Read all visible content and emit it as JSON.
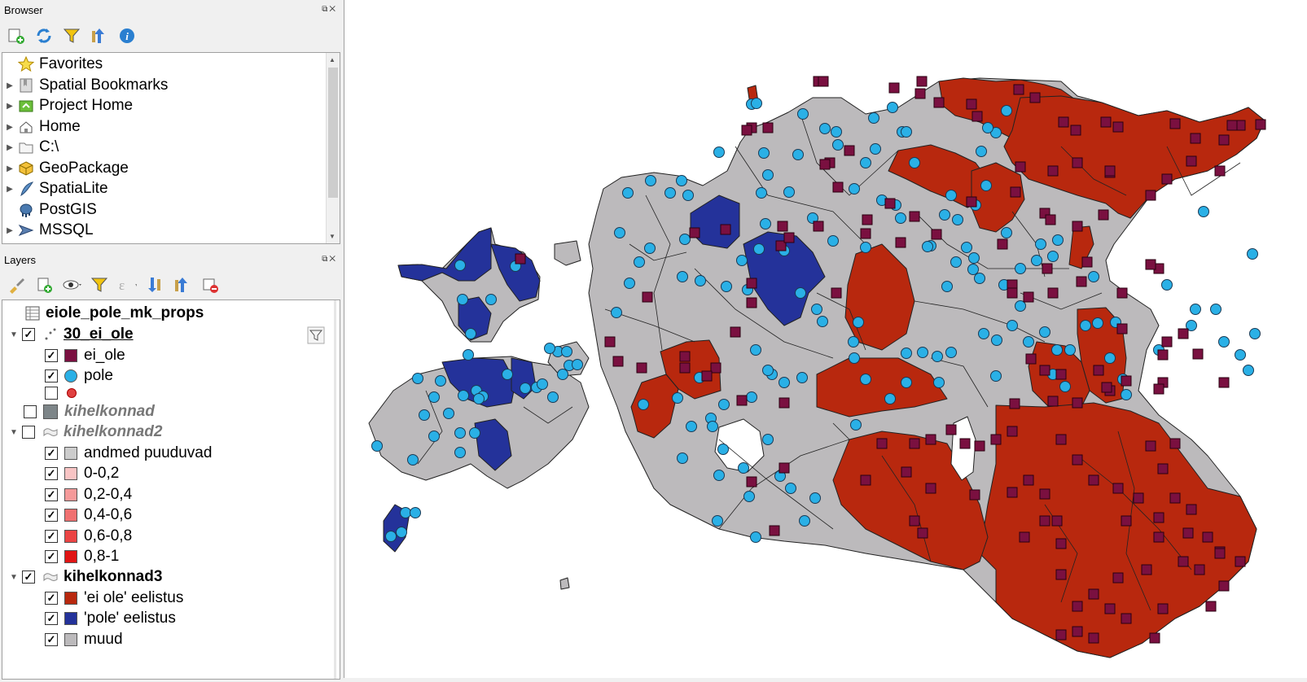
{
  "browser": {
    "title": "Browser",
    "items": [
      {
        "label": "Favorites",
        "icon": "star-icon"
      },
      {
        "label": "Spatial Bookmarks",
        "icon": "bookmark-icon"
      },
      {
        "label": "Project Home",
        "icon": "project-home-icon"
      },
      {
        "label": "Home",
        "icon": "home-icon"
      },
      {
        "label": "C:\\",
        "icon": "folder-icon"
      },
      {
        "label": "GeoPackage",
        "icon": "geopackage-icon"
      },
      {
        "label": "SpatiaLite",
        "icon": "spatialite-icon"
      },
      {
        "label": "PostGIS",
        "icon": "postgis-icon"
      },
      {
        "label": "MSSQL",
        "icon": "mssql-icon"
      }
    ]
  },
  "layers": {
    "title": "Layers",
    "groups": {
      "table": "eiole_pole_mk_props",
      "points": "30_ei_ole",
      "points_items": [
        "ei_ole",
        "pole",
        ""
      ],
      "kih1": "kihelkonnad",
      "kih2": "kihelkonnad2",
      "kih2_items": [
        "andmed puuduvad",
        "0-0,2",
        "0,2-0,4",
        "0,4-0,6",
        "0,6-0,8",
        "0,8-1"
      ],
      "kih3": "kihelkonnad3",
      "kih3_items": [
        "'ei ole' eelistus",
        "'pole' eelistus",
        "muud"
      ]
    }
  },
  "colors": {
    "ei_ole": "#7a1040",
    "pole": "#2ab0e6",
    "red_region": "#b8280e",
    "blue_region": "#24329a",
    "grey_region": "#bcbabc",
    "kih1_swatch": "#7d8588",
    "andmed_puuduvad": "#cccccc",
    "c1": "#f8c4c4",
    "c2": "#f59a9a",
    "c3": "#f07070",
    "c4": "#eb4444",
    "c5": "#e01414"
  }
}
